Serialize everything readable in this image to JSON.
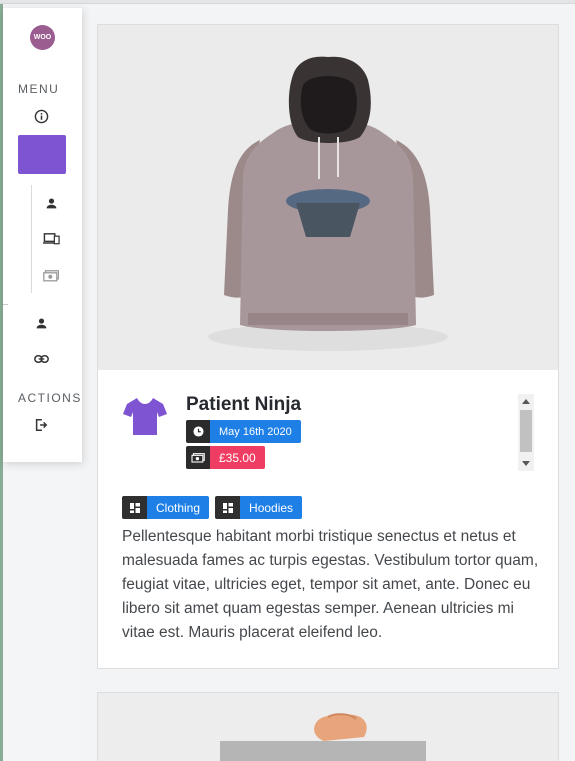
{
  "sidebar": {
    "logo_text": "WOO",
    "menu_title": "MENU",
    "actions_title": "ACTIONS",
    "icons": [
      "info-icon",
      "user-icon",
      "devices-icon",
      "money-icon",
      "account-icon",
      "link-icon",
      "logout-icon"
    ],
    "accent": "#7f54d3"
  },
  "product": {
    "title": "Patient Ninja",
    "date": "May 16th 2020",
    "price": "£35.00",
    "categories": [
      "Clothing",
      "Hoodies"
    ],
    "description": "Pellentesque habitant morbi tristique senectus et netus et malesuada fames ac turpis egestas. Vestibulum tortor quam, feugiat vitae, ultricies eget, tempor sit amet, ante. Donec eu libero sit amet quam egestas semper. Aenean ultricies mi vitae est. Mauris placerat eleifend leo.",
    "colors": {
      "date_badge": "#1e7fe6",
      "price_badge": "#ef3c63",
      "tag": "#1e7fe6"
    }
  }
}
